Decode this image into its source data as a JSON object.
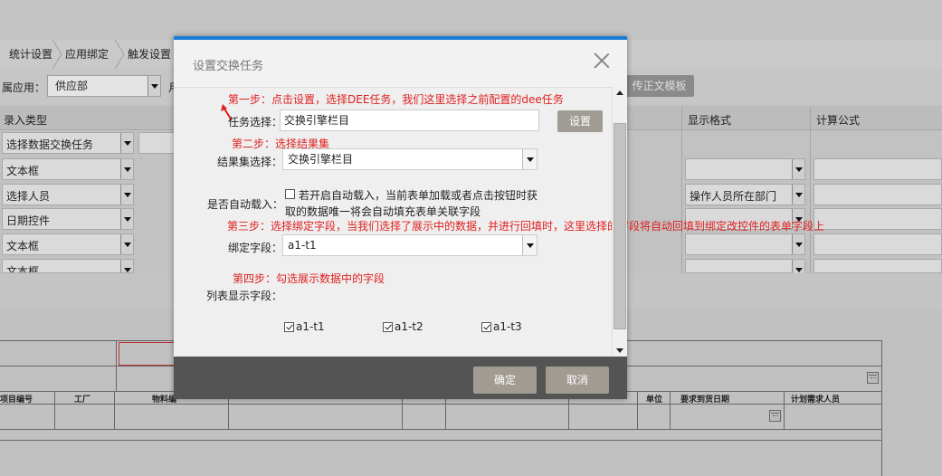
{
  "background": {
    "tabs": [
      "统计设置",
      "应用绑定",
      "触发设置"
    ],
    "toolbar": {
      "app_label": "属应用：",
      "app_value": "供应部",
      "right_button": "传正文模板"
    },
    "grid_headers": {
      "entry_type": "录入类型",
      "display_format": "显示格式",
      "calc_formula": "计算公式"
    },
    "entry_rows": [
      "选择数据交换任务",
      "文本框",
      "选择人员",
      "日期控件",
      "文本框",
      "文本框"
    ],
    "display_rows": [
      "",
      "",
      "操作人员所在部门",
      "",
      "",
      ""
    ],
    "lower_table_headers": [
      "项目编号",
      "工厂",
      "物料编",
      "单位",
      "要求到货日期",
      "计划需求人员"
    ]
  },
  "modal": {
    "title": "设置交换任务",
    "step1_note": "第一步：点击设置，选择DEE任务，我们这里选择之前配置的dee任务",
    "task_label": "任务选择：",
    "task_value": "交换引擎栏目",
    "set_button": "设置",
    "step2_note": "第二步：选择结果集",
    "resultset_label": "结果集选择：",
    "resultset_value": "交换引擎栏目",
    "auto_load_label": "是否自动载入：",
    "auto_load_text_line1": "若开启自动载入，当前表单加载或者点击按钮时获",
    "auto_load_text_line2": "取的数据唯一将会自动填充表单关联字段",
    "step3_note": "第三步：选择绑定字段，当我们选择了展示中的数据，并进行回填时，这里选择的字段将自动回填到绑定改控件的表单字段上",
    "bind_label": "绑定字段：",
    "bind_value": "a1-t1",
    "step4_note": "第四步：勾选展示数据中的字段",
    "list_fields_label": "列表显示字段：",
    "fields": [
      {
        "label": "a1-t1",
        "checked": true
      },
      {
        "label": "a1-t2",
        "checked": true
      },
      {
        "label": "a1-t3",
        "checked": true
      }
    ],
    "ok_button": "确定",
    "cancel_button": "取消"
  },
  "colors": {
    "accent_bar": "#1a7fd6",
    "note_red": "#e02020",
    "footer_bg": "#545454",
    "button_bg": "#a19b91"
  }
}
